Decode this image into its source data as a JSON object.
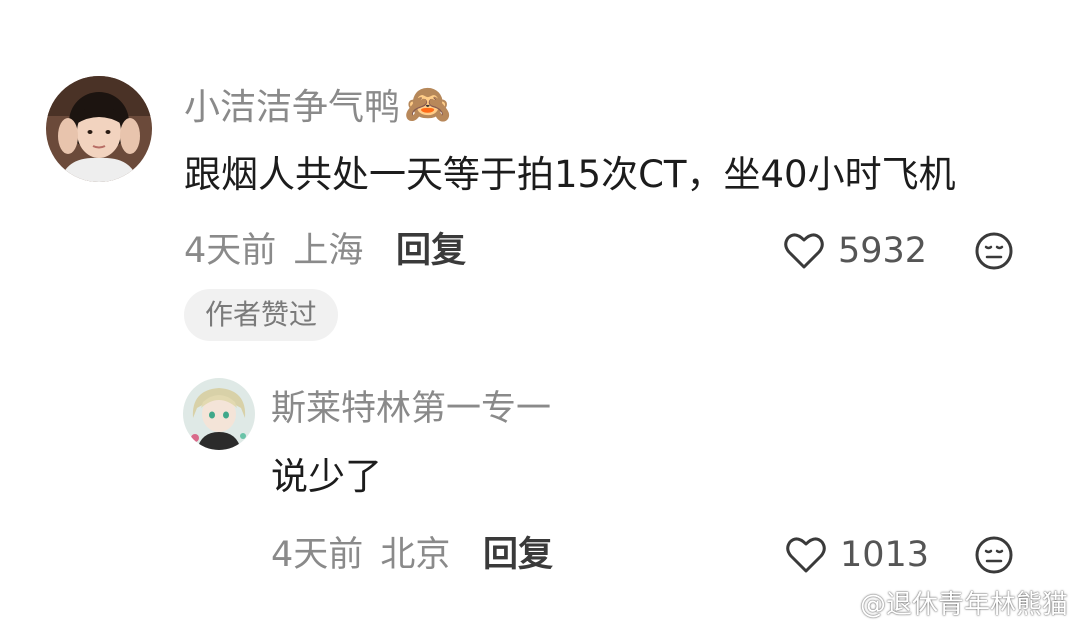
{
  "colors": {
    "username": "#8a8a8a",
    "meta": "#8a8a8a",
    "body_text": "#1c1c1c",
    "badge_bg": "#f1f1f1"
  },
  "comment": {
    "username": "小洁洁争气鸭",
    "username_emoji": "🙈",
    "text": "跟烟人共处一天等于拍15次CT，坐40小时飞机",
    "time": "4天前",
    "location": "上海",
    "reply_label": "回复",
    "likes": "5932",
    "author_badge": "作者赞过"
  },
  "reply": {
    "username": "斯莱特林第一专一",
    "text": "说少了",
    "time": "4天前",
    "location": "北京",
    "reply_label": "回复",
    "likes": "1013"
  },
  "watermark": {
    "text": "@退休青年林熊猫",
    "icon": "weibo-icon"
  }
}
